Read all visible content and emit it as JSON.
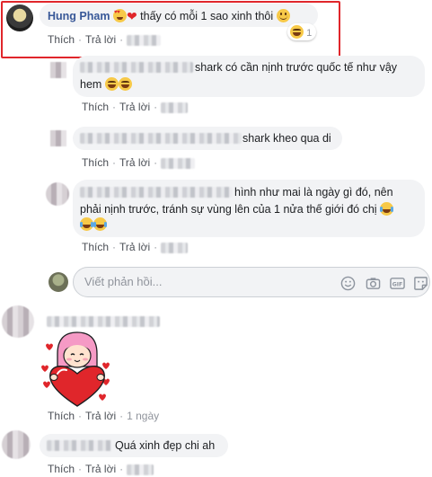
{
  "comment": {
    "author": "Hung Pham",
    "text": "thấy có mỗi 1 sao xinh thôi",
    "reaction_count": "1"
  },
  "replies": [
    {
      "text_line1": "shark có cần nịnh trước quốc tế như vậy",
      "text_line2": "hem"
    },
    {
      "text": "shark kheo qua di"
    },
    {
      "text_line1": "hình như mai là ngày gì đó, nên",
      "text_line2": "phải nịnh trước, tránh sự vùng lên của 1 nửa thế giới đó chị"
    }
  ],
  "reply_box": {
    "placeholder": "Viết phản hồi..."
  },
  "comment2": {
    "time": "1 ngày"
  },
  "comment3": {
    "text": "Quá xinh đẹp chi ah"
  },
  "actions": {
    "like": "Thích",
    "reply": "Trả lời",
    "separator": "·"
  },
  "icons": [
    "laugh-emoji",
    "smile-emoji",
    "heart-eyes-emoji",
    "heart",
    "crying-laugh-emoji",
    "emoji-picker-icon",
    "camera-icon",
    "gif-icon",
    "sticker-icon"
  ]
}
